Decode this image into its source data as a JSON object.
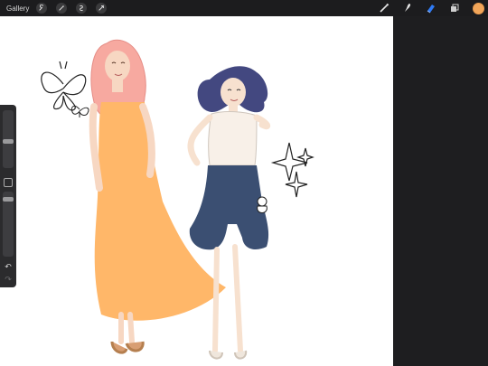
{
  "topbar": {
    "gallery_label": "Gallery",
    "left_tools": [
      "wrench-icon",
      "magic-wand-icon",
      "selection-icon",
      "transform-arrow-icon"
    ],
    "right_tools": [
      "brush-icon",
      "smudge-icon",
      "eraser-icon",
      "layers-icon"
    ],
    "active_tool": "eraser-icon",
    "current_color": "#f2a65a"
  },
  "sidebar": {
    "brush_size_level": 0.6,
    "opacity_level": 0.8,
    "undo_icon": "undo-icon",
    "redo_icon": "redo-icon"
  },
  "canvas": {
    "background": "#ffffff"
  }
}
